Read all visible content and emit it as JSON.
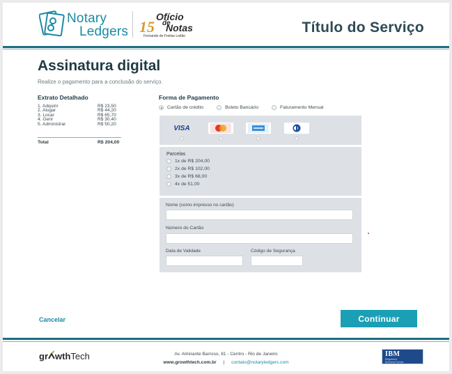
{
  "header": {
    "brand_line1": "Notary",
    "brand_line2": "Ledgers",
    "partner_number": "15",
    "partner_oficio": "Ofício",
    "partner_de": "de",
    "partner_notas": "Notas",
    "partner_sub": "Fernando de Freitas Leitão",
    "service_title": "Título do Serviço"
  },
  "page": {
    "title": "Assinatura digital",
    "subtitle": "Realize o pagamento para a conclusão do serviço."
  },
  "extrato": {
    "title": "Extrato Detalhado",
    "items": [
      {
        "label": "1. Adquirir",
        "amount": "R$ 23,50"
      },
      {
        "label": "2. Alugar",
        "amount": "R$ 44,20"
      },
      {
        "label": "3. Locar",
        "amount": "R$ 65,70"
      },
      {
        "label": "4. Gerir",
        "amount": "R$ 30,40"
      },
      {
        "label": "5. Administrar",
        "amount": "R$ 50,20"
      }
    ],
    "total_label": "Total",
    "total_amount": "R$ 204,00"
  },
  "payment": {
    "title": "Forma de Pagamento",
    "methods": [
      {
        "label": "Cartão de crédito",
        "selected": true
      },
      {
        "label": "Boleto Bancário",
        "selected": false
      },
      {
        "label": "Faturamento Mensal",
        "selected": false
      }
    ],
    "cards": [
      {
        "name": "visa-icon",
        "label": "VISA"
      },
      {
        "name": "mastercard-icon",
        "label": ""
      },
      {
        "name": "amex-icon",
        "label": ""
      },
      {
        "name": "diners-icon",
        "label": ""
      }
    ],
    "parcelas_title": "Parcelas",
    "parcelas": [
      "1x de R$ 204,00",
      "2x de R$ 102,00",
      "3x de R$ 68,00",
      "4x de 51,00"
    ],
    "fields": {
      "name_label": "Nome (como impresso no cartão)",
      "name_value": "",
      "number_label": "Número do Cartão",
      "number_value": "",
      "expiry_label": "Data de Validade",
      "expiry_value": "",
      "cvv_label": "Código de Segurança",
      "cvv_value": ""
    }
  },
  "actions": {
    "cancel": "Cancelar",
    "continue": "Continuar"
  },
  "footer": {
    "logo_gr": "gr",
    "logo_wth": "wth",
    "logo_tech": "Tech",
    "address": "Av. Almirante Barroso, 81 - Centro - Rio de Janeiro",
    "site": "www.growthtech.com.br",
    "separator": "|",
    "email": "contato@notaryledgers.com",
    "ibm": "IBM",
    "ibm_sub1": "Registered",
    "ibm_sub2": "Business Partner"
  },
  "colors": {
    "accent": "#1a9fb5",
    "header_rule": "#1c6d80",
    "panel": "#dde1e6",
    "title": "#1f3a45"
  }
}
